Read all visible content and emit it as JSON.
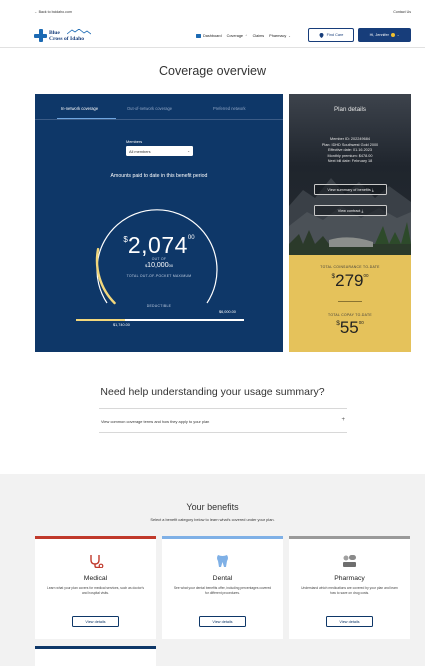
{
  "utility": {
    "back": "← Back to bcidaho.com",
    "contact": "Contact Us"
  },
  "logo": {
    "line1": "Blue",
    "line2": "Cross of Idaho"
  },
  "nav": {
    "items": [
      {
        "label": "Dashboard",
        "icon": "dashboard-icon"
      },
      {
        "label": "Coverage",
        "chevron": "⌃"
      },
      {
        "label": "Claims"
      },
      {
        "label": "Pharmacy",
        "chevron": "⌄"
      }
    ],
    "find_care": "Find Care",
    "user": "Hi, Jennifer"
  },
  "page_title": "Coverage overview",
  "tabs": [
    "In-network coverage",
    "Out-of-network coverage",
    "Preferred network"
  ],
  "members": {
    "label": "Members",
    "selected": "All members"
  },
  "amounts_label": "Amounts paid to date in this benefit period",
  "oop": {
    "currency": "$",
    "amount": "2,074",
    "cents": "00",
    "out_of": "OUT OF",
    "max": "10,000",
    "max_cents": "00",
    "max_label": "TOTAL OUT-OF-POCKET MAXIMUM",
    "progress": 0.2074
  },
  "deductible": {
    "label": "DEDUCTIBLE",
    "max_text": "$6,000.00",
    "current_text": "$1,740.00",
    "progress": 0.29
  },
  "plan": {
    "title": "Plan details",
    "lines": [
      "Member ID: 202249684",
      "Plan: IDHD Southwest Gold 2000",
      "Effective date: 01.16.2023",
      "Monthly premium: $478.00",
      "Next bill date: February 18"
    ],
    "btn_summary": "View summary of benefits ⤓",
    "btn_contract": "View contract ⤓"
  },
  "costs": {
    "coinsurance_label": "TOTAL COINSURANCE TO-DATE",
    "coinsurance": "279",
    "coinsurance_cents": "00",
    "copay_label": "TOTAL COPAY TO-DATE",
    "copay": "55",
    "copay_cents": "00"
  },
  "help": {
    "title": "Need help understanding your usage summary?",
    "faq": "View common coverage terms and how they apply to your plan",
    "plus": "+"
  },
  "benefits": {
    "title": "Your benefits",
    "subtitle": "Select a benefit category below to learn what's covered under your plan.",
    "cards": [
      {
        "name": "Medical",
        "desc": "Learn what your plan covers for medical services, such as doctor's and hospital visits.",
        "button": "View details",
        "color": "#c0392b",
        "icon": "stethoscope-icon"
      },
      {
        "name": "Dental",
        "desc": "See what your dental benefits offer, including percentages covered for different procedures.",
        "button": "View details",
        "color": "#7fb0e6",
        "icon": "tooth-icon"
      },
      {
        "name": "Pharmacy",
        "desc": "Understand which medications are covered by your plan and learn how to save on drug costs.",
        "button": "View details",
        "color": "#9a9a9a",
        "icon": "pills-icon"
      }
    ]
  },
  "colors": {
    "navy": "#0e3768",
    "gold": "#e5c25b",
    "arc_gold": "#f2d77c"
  }
}
